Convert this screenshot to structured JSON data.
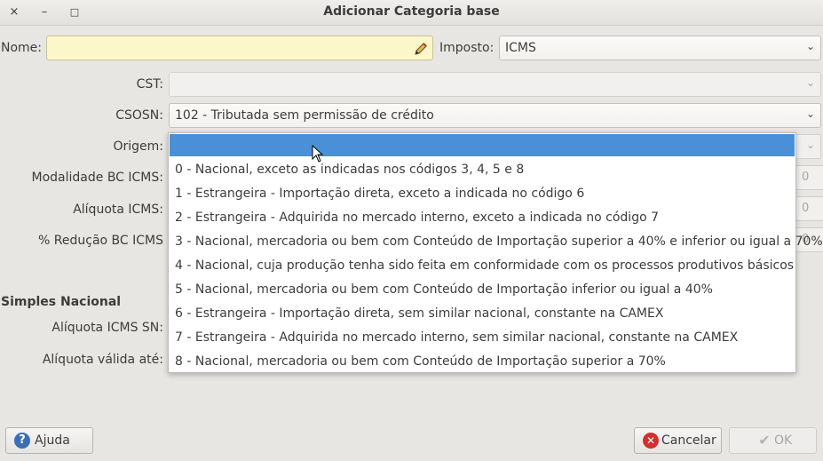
{
  "window": {
    "title": "Adicionar Categoria base",
    "close_glyph": "×",
    "minimize_glyph": "–",
    "maximize_glyph": "□"
  },
  "form": {
    "nome_label": "Nome:",
    "nome_value": "",
    "imposto_label": "Imposto:",
    "imposto_value": "ICMS",
    "cst_label": "CST:",
    "cst_value": "",
    "csosn_label": "CSOSN:",
    "csosn_value": "102 - Tributada sem permissão de crédito",
    "origem_label": "Origem:",
    "modalidade_label": "Modalidade BC ICMS:",
    "aliquota_label": "Alíquota ICMS:",
    "reducao_label": "% Redução BC ICMS",
    "spin_stub_value": "0"
  },
  "simples": {
    "title": "Simples Nacional",
    "aliquota_sn_label": "Alíquota ICMS SN:",
    "valida_label": "Alíquota válida até:"
  },
  "origem_options": [
    "0 - Nacional, exceto as indicadas nos códigos 3, 4, 5 e 8",
    "1 - Estrangeira - Importação direta, exceto a indicada no código 6",
    "2 - Estrangeira - Adquirida no mercado interno, exceto a indicada no código 7",
    "3 - Nacional, mercadoria ou bem com Conteúdo de Importação superior a 40% e inferior ou igual a 70%",
    "4 - Nacional, cuja produção tenha sido feita em conformidade com os processos produtivos básicos",
    "5 - Nacional, mercadoria ou bem com Conteúdo de Importação inferior ou igual a 40%",
    "6 - Estrangeira - Importação direta, sem similar nacional, constante na CAMEX",
    "7 - Estrangeira - Adquirida no mercado interno, sem similar nacional, constante na CAMEX",
    "8 - Nacional, mercadoria ou bem com Conteúdo de Importação superior a 70%"
  ],
  "buttons": {
    "help": "Ajuda",
    "cancel": "Cancelar",
    "ok": "OK"
  },
  "colors": {
    "selection": "#4a90d9",
    "name_field_bg": "#fcf7c8",
    "help_icon": "#3a6fb6",
    "cancel_icon": "#d32f2f",
    "ok_icon": "#b5b3b0"
  },
  "icons": {
    "edit": "pencil-icon",
    "chevron": "chevron-down-icon",
    "help": "help-icon",
    "cancel": "cancel-icon",
    "ok": "check-icon"
  }
}
